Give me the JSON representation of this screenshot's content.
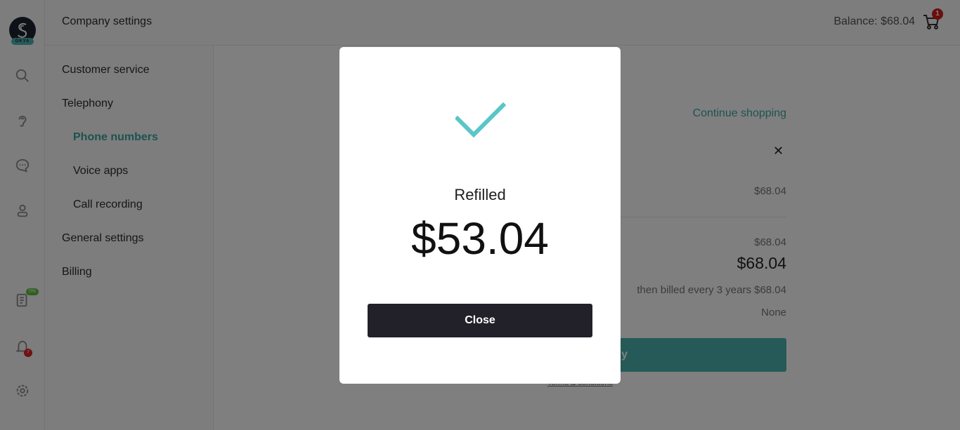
{
  "app": {
    "logo_text": "OKYA"
  },
  "rail": {
    "reports_badge": "0%",
    "notifications_badge": "7"
  },
  "header": {
    "title": "Company settings",
    "balance_label": "Balance:",
    "balance_value": "$68.04",
    "cart_count": "1"
  },
  "subnav": {
    "items": [
      {
        "label": "Customer service"
      },
      {
        "label": "Telephony"
      },
      {
        "label": "Phone numbers"
      },
      {
        "label": "Voice apps"
      },
      {
        "label": "Call recording"
      },
      {
        "label": "General settings"
      },
      {
        "label": "Billing"
      }
    ]
  },
  "cart": {
    "continue_label": "Continue shopping",
    "item_price": "$68.04",
    "subtotal": "$68.04",
    "total": "$68.04",
    "billing_note": "then billed every 3 years $68.04",
    "discount": "None",
    "pay_label": "y",
    "terms_label": "Terms & conditions"
  },
  "modal": {
    "label": "Refilled",
    "amount": "$53.04",
    "close_label": "Close"
  },
  "colors": {
    "accent": "#3aa6a1",
    "check": "#5ac6c7",
    "modal_button": "#222129",
    "badge_red": "#d51c1c"
  }
}
